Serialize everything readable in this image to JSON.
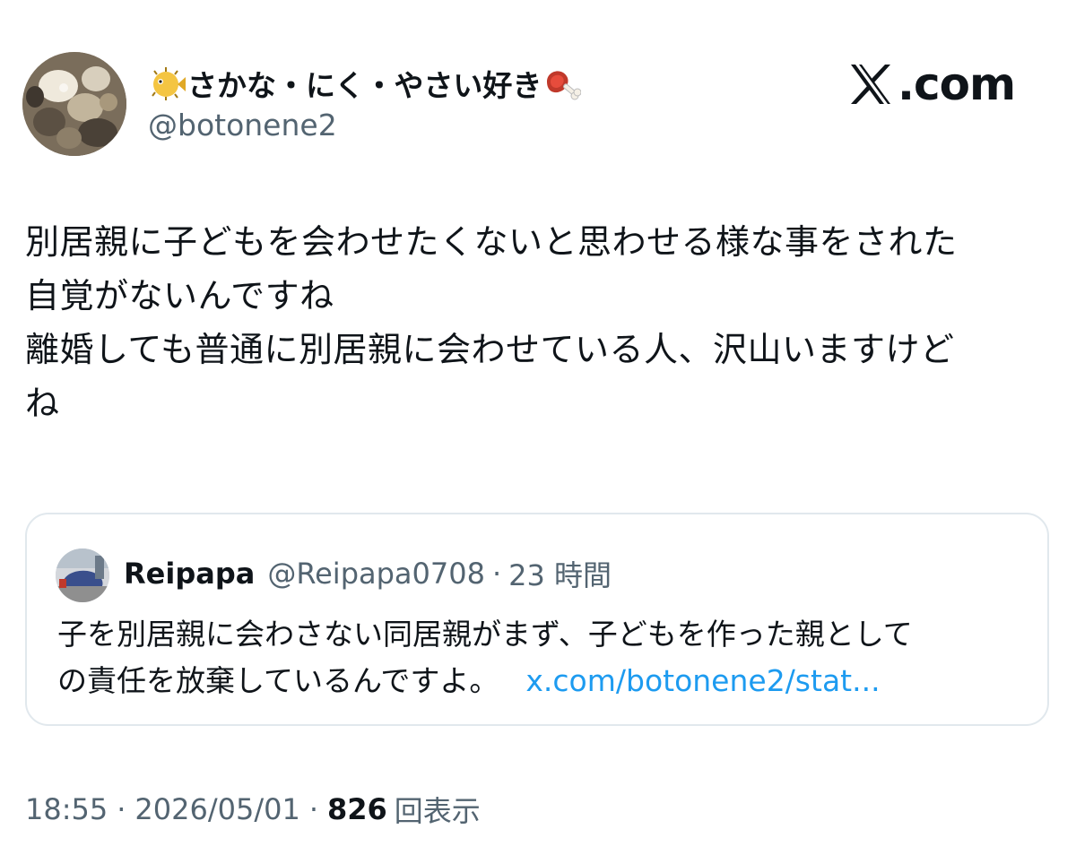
{
  "author": {
    "display_name": "さかな・にく・やさい好き",
    "handle": "@botonene2",
    "leading_emoji": "blowfish-icon",
    "trailing_emoji": "meat-on-bone-icon"
  },
  "brand": {
    "label": ".com",
    "icon": "x-logo-icon"
  },
  "tweet": {
    "lines": [
      "別居親に子どもを会わせたくないと思わせる様な事をされた",
      "自覚がないんですね",
      "離婚しても普通に別居親に会わせている人、沢山いますけど",
      "ね"
    ]
  },
  "quoted_tweet": {
    "name": "Reipapa",
    "handle": "@Reipapa0708",
    "separator": "·",
    "time": "23 時間",
    "lines": [
      "子を別居親に会わさない同居親がまず、子どもを作った親として",
      "の責任を放棄しているんですよ。"
    ],
    "link": "x.com/botonene2/stat..."
  },
  "meta": {
    "time": "18:55",
    "separator": "·",
    "date": "2026/05/01",
    "views_count": "826",
    "views_label": "回表示"
  },
  "colors": {
    "text": "#0f1419",
    "secondary": "#536471",
    "link": "#1d9bf0",
    "border": "#e1e8ed"
  }
}
